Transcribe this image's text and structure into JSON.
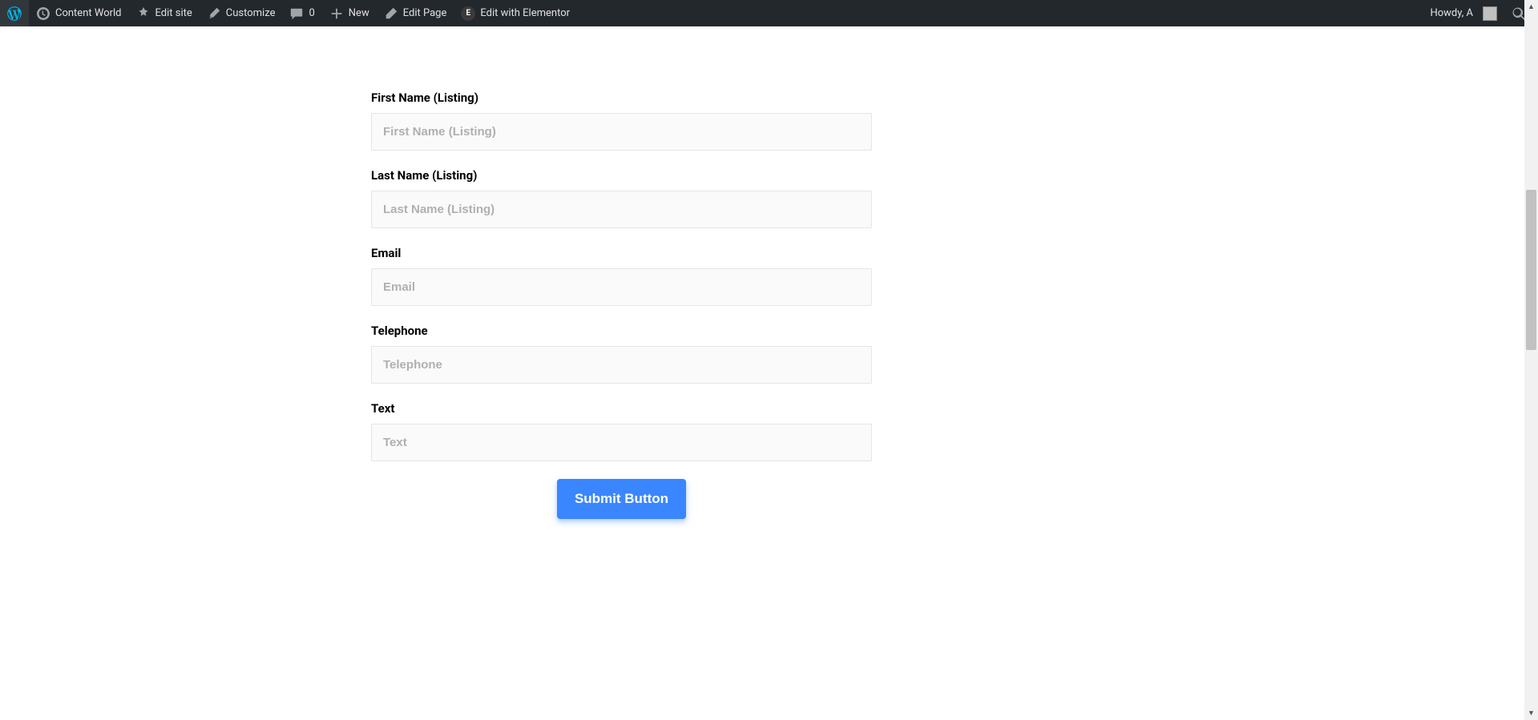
{
  "adminbar": {
    "site_name": "Content World",
    "edit_site": "Edit site",
    "customize": "Customize",
    "comments_count": "0",
    "new": "New",
    "edit_page": "Edit Page",
    "edit_elementor": "Edit with Elementor",
    "greeting": "Howdy, A"
  },
  "form": {
    "fields": [
      {
        "label": "First Name (Listing)",
        "placeholder": "First Name (Listing)",
        "name": "first-name"
      },
      {
        "label": "Last Name (Listing)",
        "placeholder": "Last Name (Listing)",
        "name": "last-name"
      },
      {
        "label": "Email",
        "placeholder": "Email",
        "name": "email"
      },
      {
        "label": "Telephone",
        "placeholder": "Telephone",
        "name": "telephone"
      },
      {
        "label": "Text",
        "placeholder": "Text",
        "name": "text"
      }
    ],
    "submit_label": "Submit Button"
  }
}
